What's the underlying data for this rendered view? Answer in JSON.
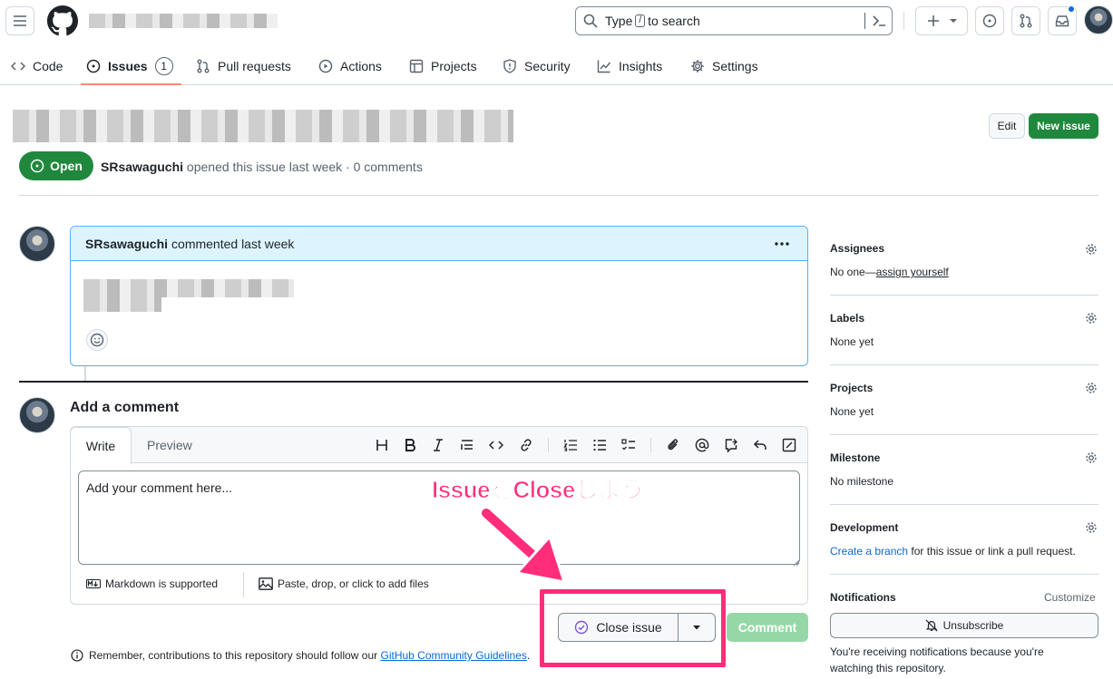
{
  "header": {
    "search_prefix": "Type",
    "search_key": "/",
    "search_suffix": "to search"
  },
  "nav": {
    "tabs": [
      {
        "label": "Code"
      },
      {
        "label": "Issues",
        "count": "1"
      },
      {
        "label": "Pull requests"
      },
      {
        "label": "Actions"
      },
      {
        "label": "Projects"
      },
      {
        "label": "Security"
      },
      {
        "label": "Insights"
      },
      {
        "label": "Settings"
      }
    ]
  },
  "issue": {
    "edit_label": "Edit",
    "new_issue_label": "New issue",
    "state": "Open",
    "author": "SRsawaguchi",
    "meta": "opened this issue last week · 0 comments"
  },
  "comment": {
    "author": "SRsawaguchi",
    "meta": "commented last week"
  },
  "editor": {
    "heading": "Add a comment",
    "tab_write": "Write",
    "tab_preview": "Preview",
    "placeholder": "Add your comment here...",
    "markdown_note": "Markdown is supported",
    "attach_note": "Paste, drop, or click to add files",
    "close_label": "Close issue",
    "comment_label": "Comment",
    "reminder_prefix": "Remember, contributions to this repository should follow our",
    "reminder_link": "GitHub Community Guidelines",
    "reminder_suffix": "."
  },
  "annotation": {
    "text": "IssueをCloseしよう",
    "color": "#ff2d7a"
  },
  "sidebar": {
    "assignees": {
      "title": "Assignees",
      "value_prefix": "No one—",
      "value_link": "assign yourself"
    },
    "labels": {
      "title": "Labels",
      "value": "None yet"
    },
    "projects": {
      "title": "Projects",
      "value": "None yet"
    },
    "milestone": {
      "title": "Milestone",
      "value": "No milestone"
    },
    "development": {
      "title": "Development",
      "link": "Create a branch",
      "suffix": "for this issue or link a pull request."
    },
    "notifications": {
      "title": "Notifications",
      "customize": "Customize",
      "button": "Unsubscribe",
      "note": "You're receiving notifications because you're watching this repository."
    }
  },
  "colors": {
    "accent": "#0969da",
    "success": "#1f883d",
    "success_dark": "#116329",
    "border": "#d1d9e0"
  }
}
